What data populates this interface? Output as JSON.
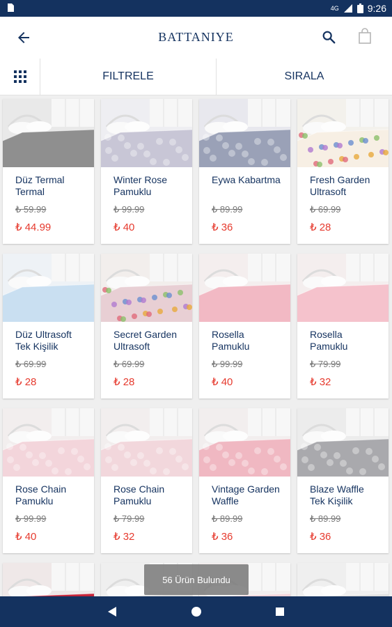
{
  "status": {
    "time": "9:26",
    "network": "4G"
  },
  "header": {
    "title": "BATTANIYE"
  },
  "toolbar": {
    "filter_label": "FILTRELE",
    "sort_label": "SIRALA"
  },
  "products": [
    {
      "name": "Düz Termal Termal",
      "old_price": "₺ 59.99",
      "price": "₺ 44.99",
      "bg": "#e9e9e9",
      "fabric": "#8f8f8f",
      "pattern": "plain"
    },
    {
      "name": "Winter Rose Pamuklu",
      "old_price": "₺ 99.99",
      "price": "₺ 40",
      "bg": "#eeeef2",
      "fabric": "#c8c6d6",
      "pattern": "flower"
    },
    {
      "name": "Eywa Kabartma",
      "old_price": "₺ 89.99",
      "price": "₺ 36",
      "bg": "#e8e8ee",
      "fabric": "#9aa1b7",
      "pattern": "flower"
    },
    {
      "name": "Fresh Garden Ultrasoft",
      "old_price": "₺ 69.99",
      "price": "₺ 28",
      "bg": "#f3f1ec",
      "fabric": "#f7efe4",
      "pattern": "colorful"
    },
    {
      "name": "Düz Ultrasoft Tek Kişilik",
      "old_price": "₺ 69.99",
      "price": "₺ 28",
      "bg": "#eef2f6",
      "fabric": "#c9dff1",
      "pattern": "plain"
    },
    {
      "name": "Secret Garden Ultrasoft",
      "old_price": "₺ 69.99",
      "price": "₺ 28",
      "bg": "#f2eeec",
      "fabric": "#e8cfd4",
      "pattern": "colorful"
    },
    {
      "name": "Rosella Pamuklu",
      "old_price": "₺ 99.99",
      "price": "₺ 40",
      "bg": "#f4eeee",
      "fabric": "#f2b9c4",
      "pattern": "plain"
    },
    {
      "name": "Rosella Pamuklu",
      "old_price": "₺ 79.99",
      "price": "₺ 32",
      "bg": "#f4eeee",
      "fabric": "#f5c2cc",
      "pattern": "plain"
    },
    {
      "name": "Rose Chain Pamuklu",
      "old_price": "₺ 99.99",
      "price": "₺ 40",
      "bg": "#f2eeee",
      "fabric": "#f3d5db",
      "pattern": "flower"
    },
    {
      "name": "Rose Chain Pamuklu",
      "old_price": "₺ 79.99",
      "price": "₺ 32",
      "bg": "#f2eeee",
      "fabric": "#f2d7dc",
      "pattern": "flower"
    },
    {
      "name": "Vintage Garden Waffle",
      "old_price": "₺ 89.99",
      "price": "₺ 36",
      "bg": "#f2eeee",
      "fabric": "#f0b8c2",
      "pattern": "flower"
    },
    {
      "name": "Blaze Waffle Tek Kişilik",
      "old_price": "₺ 89.99",
      "price": "₺ 36",
      "bg": "#ececec",
      "fabric": "#a9a9ad",
      "pattern": "flower"
    }
  ],
  "partial_products": [
    {
      "bg": "#efe8e8",
      "fabric": "#c7253a"
    },
    {
      "bg": "#efefef",
      "fabric": "#dcdcdc"
    },
    {
      "bg": "#f2eeee",
      "fabric": "#f3d5db"
    },
    {
      "bg": "#efefef",
      "fabric": "#e1e1e1"
    }
  ],
  "footer": {
    "result_count": "56 Ürün Bulundu"
  },
  "colors": {
    "primary": "#14325f",
    "sale_price": "#e63a2e"
  }
}
